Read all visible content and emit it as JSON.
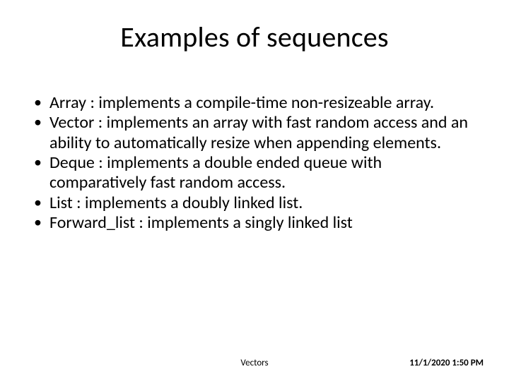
{
  "title": "Examples of sequences",
  "bullets": [
    "Array   :  implements a compile-time non-resizeable array.",
    "Vector : implements an array with fast random access and an ability to automatically resize when appending elements.",
    "Deque : implements a double ended queue with comparatively fast random access.",
    "List : implements a doubly linked list.",
    "Forward_list : implements a singly linked list"
  ],
  "footer": {
    "center": "Vectors",
    "right": "11/1/2020 1:50 PM"
  }
}
